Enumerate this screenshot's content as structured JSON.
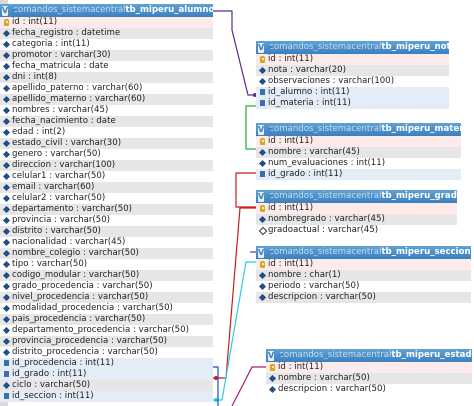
{
  "colors": {
    "header_start": "#5fa2d4",
    "header_end": "#3b7fc0",
    "row_alt": "#e6e6e6",
    "link_purple": "#5a2d8c",
    "link_blue": "#1f4fbf",
    "link_green": "#2eaa2e",
    "link_red": "#c81e1e",
    "link_cyan": "#2ecbe0",
    "link_magenta": "#a51e7a"
  },
  "icons": {
    "close": "close-icon",
    "properties": "chevron-down-icon",
    "primary_key": "key-icon",
    "not_null_column": "filled-diamond-icon",
    "nullable_column": "hollow-diamond-icon",
    "index_column": "index-square-icon"
  },
  "tables": [
    {
      "id": "alumnos",
      "db": "comandos_sistemacentral",
      "name": "tb_miperu_alumnos",
      "rows": [
        {
          "text": "id : int(11)",
          "icon": "key"
        },
        {
          "text": "fecha_registro : datetime",
          "icon": "filled"
        },
        {
          "text": "categoria : int(11)",
          "icon": "filled"
        },
        {
          "text": "promotor : varchar(30)",
          "icon": "filled"
        },
        {
          "text": "fecha_matricula : date",
          "icon": "filled"
        },
        {
          "text": "dni : int(8)",
          "icon": "filled"
        },
        {
          "text": "apellido_paterno : varchar(60)",
          "icon": "filled"
        },
        {
          "text": "apellido_materno : varchar(60)",
          "icon": "filled"
        },
        {
          "text": "nombres : varchar(45)",
          "icon": "filled"
        },
        {
          "text": "fecha_nacimiento : date",
          "icon": "filled"
        },
        {
          "text": "edad : int(2)",
          "icon": "filled"
        },
        {
          "text": "estado_civil : varchar(30)",
          "icon": "filled"
        },
        {
          "text": "genero : varchar(50)",
          "icon": "filled"
        },
        {
          "text": "direccion : varchar(100)",
          "icon": "filled"
        },
        {
          "text": "celular1 : varchar(50)",
          "icon": "filled"
        },
        {
          "text": "email : varchar(60)",
          "icon": "filled"
        },
        {
          "text": "celular2 : varchar(50)",
          "icon": "filled"
        },
        {
          "text": "departamento : varchar(50)",
          "icon": "filled"
        },
        {
          "text": "provincia : varchar(50)",
          "icon": "filled"
        },
        {
          "text": "distrito : varchar(50)",
          "icon": "filled"
        },
        {
          "text": "nacionalidad : varchar(45)",
          "icon": "filled"
        },
        {
          "text": "nombre_colegio : varchar(50)",
          "icon": "filled"
        },
        {
          "text": "tipo : varchar(50)",
          "icon": "filled"
        },
        {
          "text": "codigo_modular : varchar(50)",
          "icon": "filled"
        },
        {
          "text": "grado_procedencia : varchar(50)",
          "icon": "filled"
        },
        {
          "text": "nivel_procedencia : varchar(50)",
          "icon": "filled"
        },
        {
          "text": "modalidad_procedencia : varchar(50)",
          "icon": "filled"
        },
        {
          "text": "pais_procedencia : varchar(50)",
          "icon": "filled"
        },
        {
          "text": "departamento_procedencia : varchar(50)",
          "icon": "filled"
        },
        {
          "text": "provincia_procedencia : varchar(50)",
          "icon": "filled"
        },
        {
          "text": "distrito_procedencia : varchar(50)",
          "icon": "filled"
        },
        {
          "text": "id_procedencia : int(11)",
          "icon": "sq"
        },
        {
          "text": "id_grado : int(11)",
          "icon": "sq"
        },
        {
          "text": "ciclo : varchar(50)",
          "icon": "filled"
        },
        {
          "text": "id_seccion : int(11)",
          "icon": "sq"
        }
      ]
    },
    {
      "id": "notas",
      "db": "comandos_sistemacentral",
      "name": "tb_miperu_notas",
      "rows": [
        {
          "text": "id : int(11)",
          "icon": "key"
        },
        {
          "text": "nota : varchar(20)",
          "icon": "filled"
        },
        {
          "text": "observaciones : varchar(100)",
          "icon": "filled"
        },
        {
          "text": "id_alumno : int(11)",
          "icon": "sq"
        },
        {
          "text": "id_materia : int(11)",
          "icon": "sq"
        }
      ]
    },
    {
      "id": "materias",
      "db": "comandos_sistemacentral",
      "name": "tb_miperu_materias",
      "rows": [
        {
          "text": "id : int(11)",
          "icon": "key"
        },
        {
          "text": "nombre : varchar(45)",
          "icon": "filled"
        },
        {
          "text": "num_evaluaciones : int(11)",
          "icon": "filled"
        },
        {
          "text": "id_grado : int(11)",
          "icon": "sq"
        }
      ]
    },
    {
      "id": "grados",
      "db": "comandos_sistemacentral",
      "name": "tb_miperu_grados",
      "rows": [
        {
          "text": "id : int(11)",
          "icon": "key"
        },
        {
          "text": "nombregrado : varchar(45)",
          "icon": "filled"
        },
        {
          "text": "gradoactual : varchar(45)",
          "icon": "hollow"
        }
      ]
    },
    {
      "id": "secciones",
      "db": "comandos_sistemacentral",
      "name": "tb_miperu_secciones",
      "rows": [
        {
          "text": "id : int(11)",
          "icon": "key"
        },
        {
          "text": "nombre : char(1)",
          "icon": "filled"
        },
        {
          "text": "periodo : varchar(50)",
          "icon": "filled"
        },
        {
          "text": "descripcion : varchar(50)",
          "icon": "filled"
        }
      ]
    },
    {
      "id": "estados",
      "db": "comandos_sistemacentral",
      "name": "tb_miperu_estados",
      "rows": [
        {
          "text": "id : int(11)",
          "icon": "key"
        },
        {
          "text": "nombre : varchar(50)",
          "icon": "filled"
        },
        {
          "text": "descripcion : varchar(50)",
          "icon": "filled"
        }
      ]
    }
  ]
}
